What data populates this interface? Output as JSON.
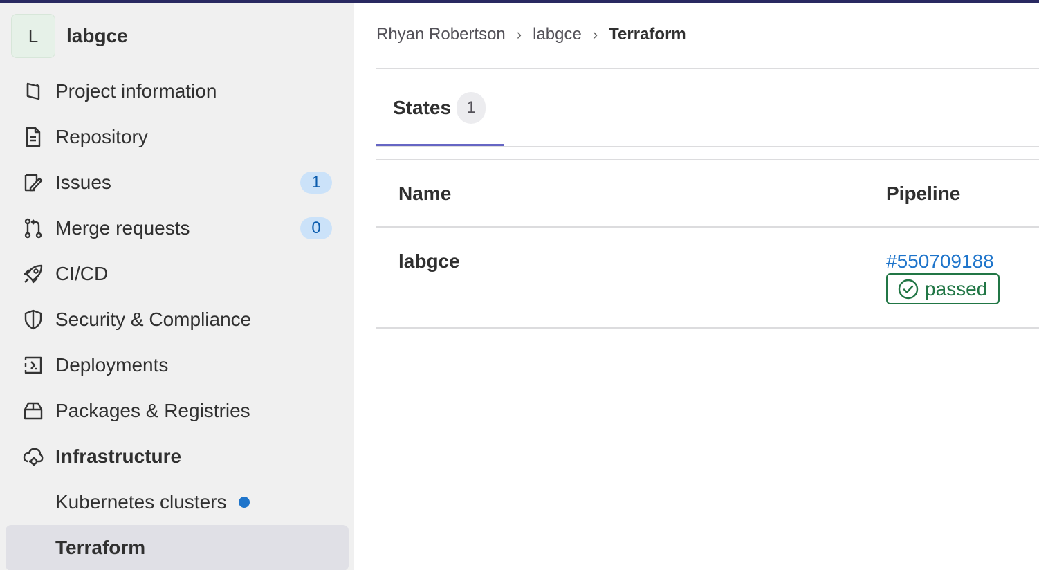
{
  "project": {
    "avatar_letter": "L",
    "name": "labgce"
  },
  "sidebar": {
    "items": [
      {
        "label": "Project information",
        "icon": "project-information-icon"
      },
      {
        "label": "Repository",
        "icon": "document-icon"
      },
      {
        "label": "Issues",
        "icon": "issues-icon",
        "badge": "1"
      },
      {
        "label": "Merge requests",
        "icon": "merge-request-icon",
        "badge": "0"
      },
      {
        "label": "CI/CD",
        "icon": "rocket-icon"
      },
      {
        "label": "Security & Compliance",
        "icon": "shield-icon"
      },
      {
        "label": "Deployments",
        "icon": "deployments-icon"
      },
      {
        "label": "Packages & Registries",
        "icon": "package-icon"
      },
      {
        "label": "Infrastructure",
        "icon": "cloud-gear-icon"
      },
      {
        "label": "Kubernetes clusters"
      },
      {
        "label": "Terraform"
      }
    ]
  },
  "breadcrumb": {
    "items": [
      "Rhyan Robertson",
      "labgce",
      "Terraform"
    ]
  },
  "tabs": [
    {
      "label": "States",
      "count": "1"
    }
  ],
  "table": {
    "headers": [
      "Name",
      "Pipeline"
    ],
    "rows": [
      {
        "name": "labgce",
        "pipeline": "#550709188",
        "status": "passed"
      }
    ]
  },
  "colors": {
    "accent": "#6666c4",
    "badge_bg": "#cbe2f9",
    "link": "#1f75cb",
    "success": "#217645",
    "sidebar_bg": "#f0f0f0",
    "topbar": "#292961"
  }
}
